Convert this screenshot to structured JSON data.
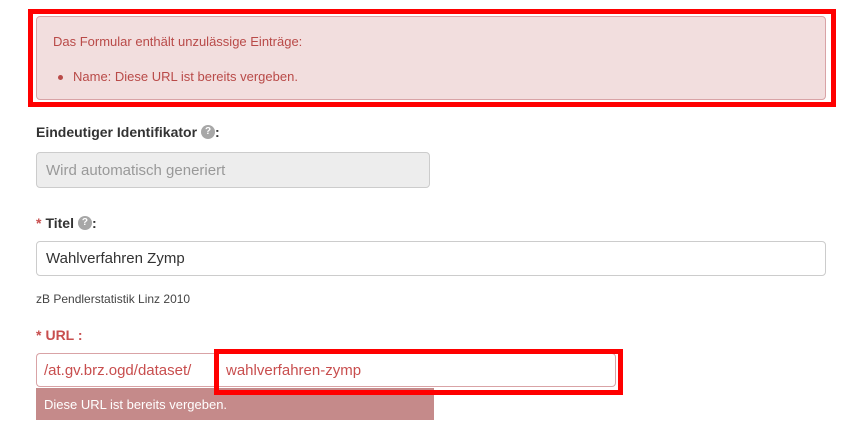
{
  "error_alert": {
    "title": "Das Formular enthält unzulässige Einträge:",
    "items": [
      "Name: Diese URL ist bereits vergeben."
    ]
  },
  "identifier": {
    "label": "Eindeutiger Identifikator",
    "suffix": ":",
    "help_icon": "?",
    "value": "Wird automatisch generiert"
  },
  "title_field": {
    "required_mark": "*",
    "label": "Titel",
    "suffix": ":",
    "help_icon": "?",
    "value": "Wahlverfahren Zymp",
    "hint": "zB Pendlerstatistik Linz 2010"
  },
  "url_field": {
    "required_mark": "*",
    "label": "URL :",
    "prefix": "/at.gv.brz.ogd/dataset/",
    "value": "wahlverfahren-zymp",
    "error": "Diese URL ist bereits vergeben."
  },
  "colors": {
    "error_text": "#b94a48",
    "error_bg": "#f2dede",
    "highlight": "#ff0000",
    "url_error_bg": "#c58a8a"
  }
}
